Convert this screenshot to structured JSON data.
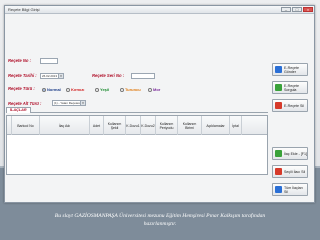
{
  "window": {
    "title": "Reçete Bilgi Girişi",
    "controls": [
      "–",
      "□",
      "×"
    ]
  },
  "form": {
    "recete_no_label": "Reçete No :",
    "recete_tarihi_label": "Reçete Tarihi :",
    "recete_tarihi_value": "26.02.2013",
    "recete_seri_no_label": "Reçete Seri No :",
    "recete_turu_label": "Reçete Türü :",
    "recete_alt_turu_label": "Reçete Alt Türü :",
    "recete_alt_turu_value": "(1) - Yatan Reçetesi",
    "radio_options": [
      {
        "label": "Normal",
        "color": "#1f3f8a",
        "selected": true
      },
      {
        "label": "Kırmızı",
        "color": "#d21f1f",
        "selected": false
      },
      {
        "label": "Yeşil",
        "color": "#1a8a2e",
        "selected": false
      },
      {
        "label": "Turuncu",
        "color": "#e07a10",
        "selected": false
      },
      {
        "label": "Mor",
        "color": "#7a2a9a",
        "selected": false
      }
    ]
  },
  "actions": {
    "e_recete_gonder": "E-Reçete Gönder",
    "e_recete_sorgula": "E-Reçete Sorgula",
    "e_recete_sil": "E-Reçete Sil",
    "ilac_ekle": "İlaç Ekle - [F1]",
    "secili_ilaci_sil": "Seçili İlacı Sil",
    "tum_ilaclari_sil": "Tüm İlaçları Sil"
  },
  "tabs": {
    "ilaclar": "İLAÇLAR"
  },
  "grid": {
    "columns": [
      "Barkod No",
      "İlaç Adı",
      "Adet",
      "Kullanım Şekli",
      "K.Dozu1",
      "K.Dozu2",
      "Kullanım Periyodu",
      "Kullanım Birimi",
      "Açıklamalar",
      "İptal"
    ]
  },
  "caption": {
    "line1": "Bu slayt GAZİOSMANPAŞA Üniversitesi mezunu Eğitim Hemşiresi Pınar Kalkışım tarafından",
    "line2": "hazırlanmıştır."
  },
  "colors": {
    "label_red": "#b0102a",
    "icon_green": "#3aa23a",
    "icon_blue": "#2a6fd6",
    "icon_red": "#d63a2a"
  }
}
